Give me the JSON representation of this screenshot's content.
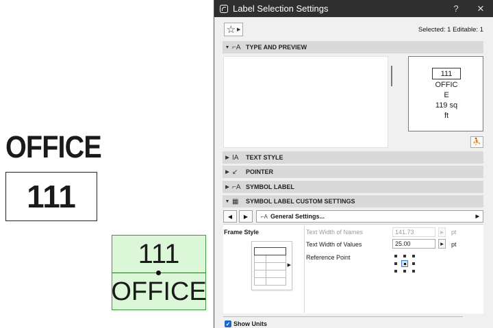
{
  "canvas": {
    "label_name": "OFFICE",
    "label_number": "111",
    "selected_label": {
      "number": "111",
      "name": "OFFICE"
    }
  },
  "dialog": {
    "title": "Label Selection Settings",
    "help_label": "?",
    "close_label": "✕",
    "favorites_icon": "star-icon",
    "favorites_label": "☆",
    "selected_info": "Selected: 1 Editable: 1",
    "panels": {
      "type_preview": "TYPE AND PREVIEW",
      "text_style": "TEXT STYLE",
      "pointer": "POINTER",
      "symbol_label": "SYMBOL LABEL",
      "custom_settings": "SYMBOL LABEL CUSTOM SETTINGS"
    },
    "preview": {
      "number": "111",
      "text": "OFFIC\nE\n119 sq\nft"
    },
    "general_settings": {
      "prev_label": "◀",
      "next_label": "▶",
      "value": "General Settings..."
    },
    "frame_style_label": "Frame Style",
    "params": {
      "names_width": {
        "label": "Text Width of Names",
        "value": "141.73",
        "unit": "pt",
        "enabled": false
      },
      "values_width": {
        "label": "Text Width of Values",
        "value": "25.00",
        "unit": "pt",
        "enabled": true
      },
      "reference_point": {
        "label": "Reference Point"
      }
    },
    "show_units": {
      "label": "Show Units",
      "checked": true
    },
    "colors": {
      "titlebar": "#2f2f2f",
      "selection_fill": "#dcf7d8",
      "selection_border": "#3a9a3a",
      "accent": "#1a66cc"
    }
  }
}
